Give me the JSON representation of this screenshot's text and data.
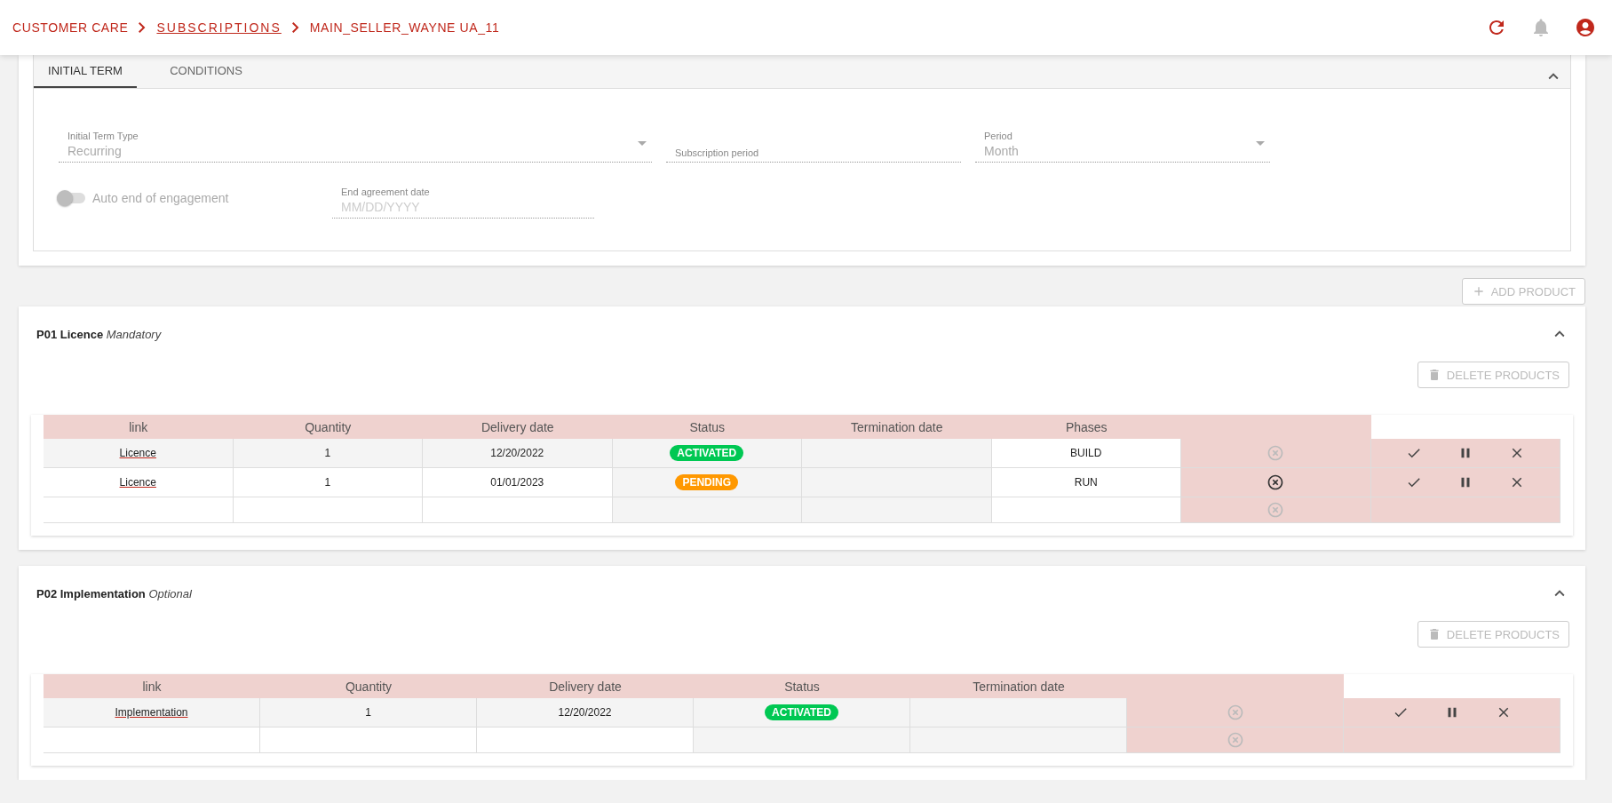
{
  "breadcrumbs": [
    {
      "label": "CUSTOMER CARE",
      "kind": "plain"
    },
    {
      "label": "SUBSCRIPTIONS",
      "kind": "link"
    },
    {
      "label": "MAIN_SELLER_WAYNE UA_11",
      "kind": "plain"
    }
  ],
  "terms": {
    "tabs": [
      {
        "label": "INITIAL TERM",
        "selected": true
      },
      {
        "label": "CONDITIONS",
        "selected": false
      }
    ],
    "initial_term_type": {
      "label": "Initial Term Type",
      "value": "Recurring"
    },
    "subscription_period": {
      "label": "Subscription period"
    },
    "period": {
      "label": "Period",
      "value": "Month"
    },
    "auto_end": {
      "label": "Auto end of engagement",
      "on": false
    },
    "end_agreement_date": {
      "label": "End agreement date",
      "placeholder": "MM/DD/YYYY"
    }
  },
  "add_product": {
    "label": "ADD PRODUCT",
    "disabled": true
  },
  "products": [
    {
      "code": "P01 Licence",
      "requirement": "Mandatory",
      "delete_button": {
        "label": "DELETE PRODUCTS",
        "disabled": true
      },
      "table": {
        "columns": [
          {
            "label": "link",
            "kind": "link"
          },
          {
            "label": "Quantity",
            "kind": "quantity"
          },
          {
            "label": "Delivery date",
            "kind": "delivery_date"
          },
          {
            "label": "Status",
            "kind": "status"
          },
          {
            "label": "Termination date",
            "kind": "termination"
          },
          {
            "label": "Phases",
            "kind": "phase"
          }
        ],
        "rows": [
          {
            "kind": "item",
            "link": "Licence",
            "quantity": "1",
            "delivery_date": "12/20/2022",
            "status": {
              "label": "ACTIVATED",
              "color": "#00c853"
            },
            "phase": "BUILD",
            "cancel_disabled": true
          },
          {
            "kind": "item",
            "link": "Licence",
            "quantity": "1",
            "delivery_date": "01/01/2023",
            "status": {
              "label": "PENDING",
              "color": "#ff9800"
            },
            "phase": "RUN",
            "cancel_disabled": false
          },
          {
            "kind": "blank",
            "cancel_disabled": true
          }
        ]
      }
    },
    {
      "code": "P02 Implementation",
      "requirement": "Optional",
      "delete_button": {
        "label": "DELETE PRODUCTS",
        "disabled": true
      },
      "table": {
        "columns": [
          {
            "label": "link",
            "kind": "link"
          },
          {
            "label": "Quantity",
            "kind": "quantity"
          },
          {
            "label": "Delivery date",
            "kind": "delivery_date"
          },
          {
            "label": "Status",
            "kind": "status"
          },
          {
            "label": "Termination date",
            "kind": "termination"
          }
        ],
        "rows": [
          {
            "kind": "item",
            "link": "Implementation",
            "quantity": "1",
            "delivery_date": "12/20/2022",
            "status": {
              "label": "ACTIVATED",
              "color": "#00c853"
            },
            "cancel_disabled": true
          },
          {
            "kind": "blank",
            "cancel_disabled": true
          }
        ]
      }
    }
  ]
}
